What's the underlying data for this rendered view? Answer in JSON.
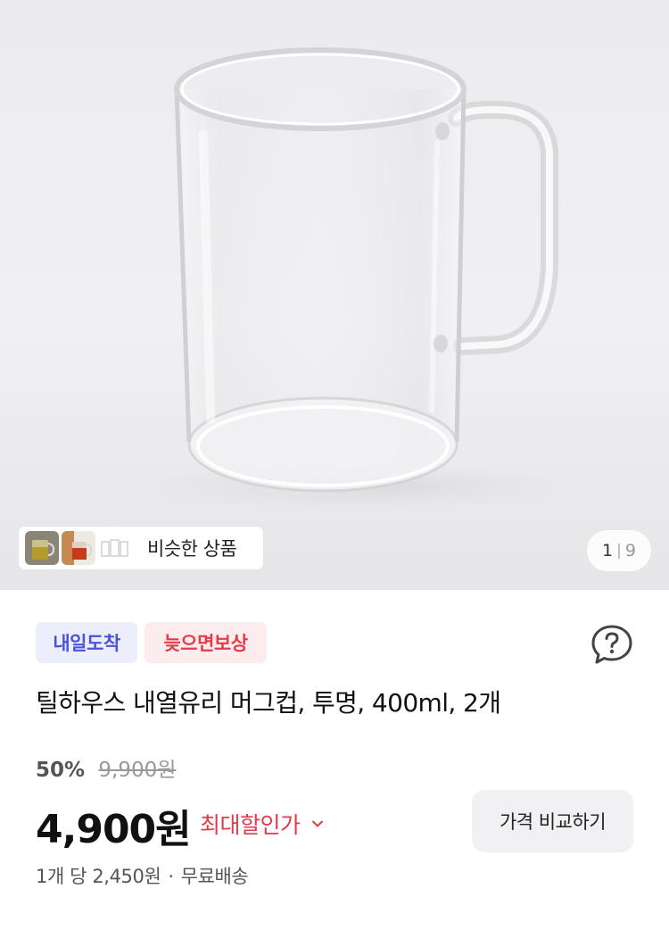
{
  "gallery": {
    "similar_label": "비슷한 상품",
    "page_current": "1",
    "page_separator": "|",
    "page_total": "9"
  },
  "badges": {
    "delivery": "내일도착",
    "compensation": "늦으면보상"
  },
  "product": {
    "title": "틸하우스 내열유리 머그컵, 투명, 400ml, 2개",
    "discount_rate": "50%",
    "original_price": "9,900원",
    "price": "4,900원",
    "max_discount_label": "최대할인가",
    "compare_button": "가격 비교하기",
    "unit_price": "1개 당 2,450원",
    "separator": "·",
    "shipping": "무료배송"
  },
  "colors": {
    "accent_red": "#e23b4b",
    "delivery_blue": "#4a52d6"
  },
  "icons": [
    "help-icon",
    "chevron-down-icon"
  ]
}
